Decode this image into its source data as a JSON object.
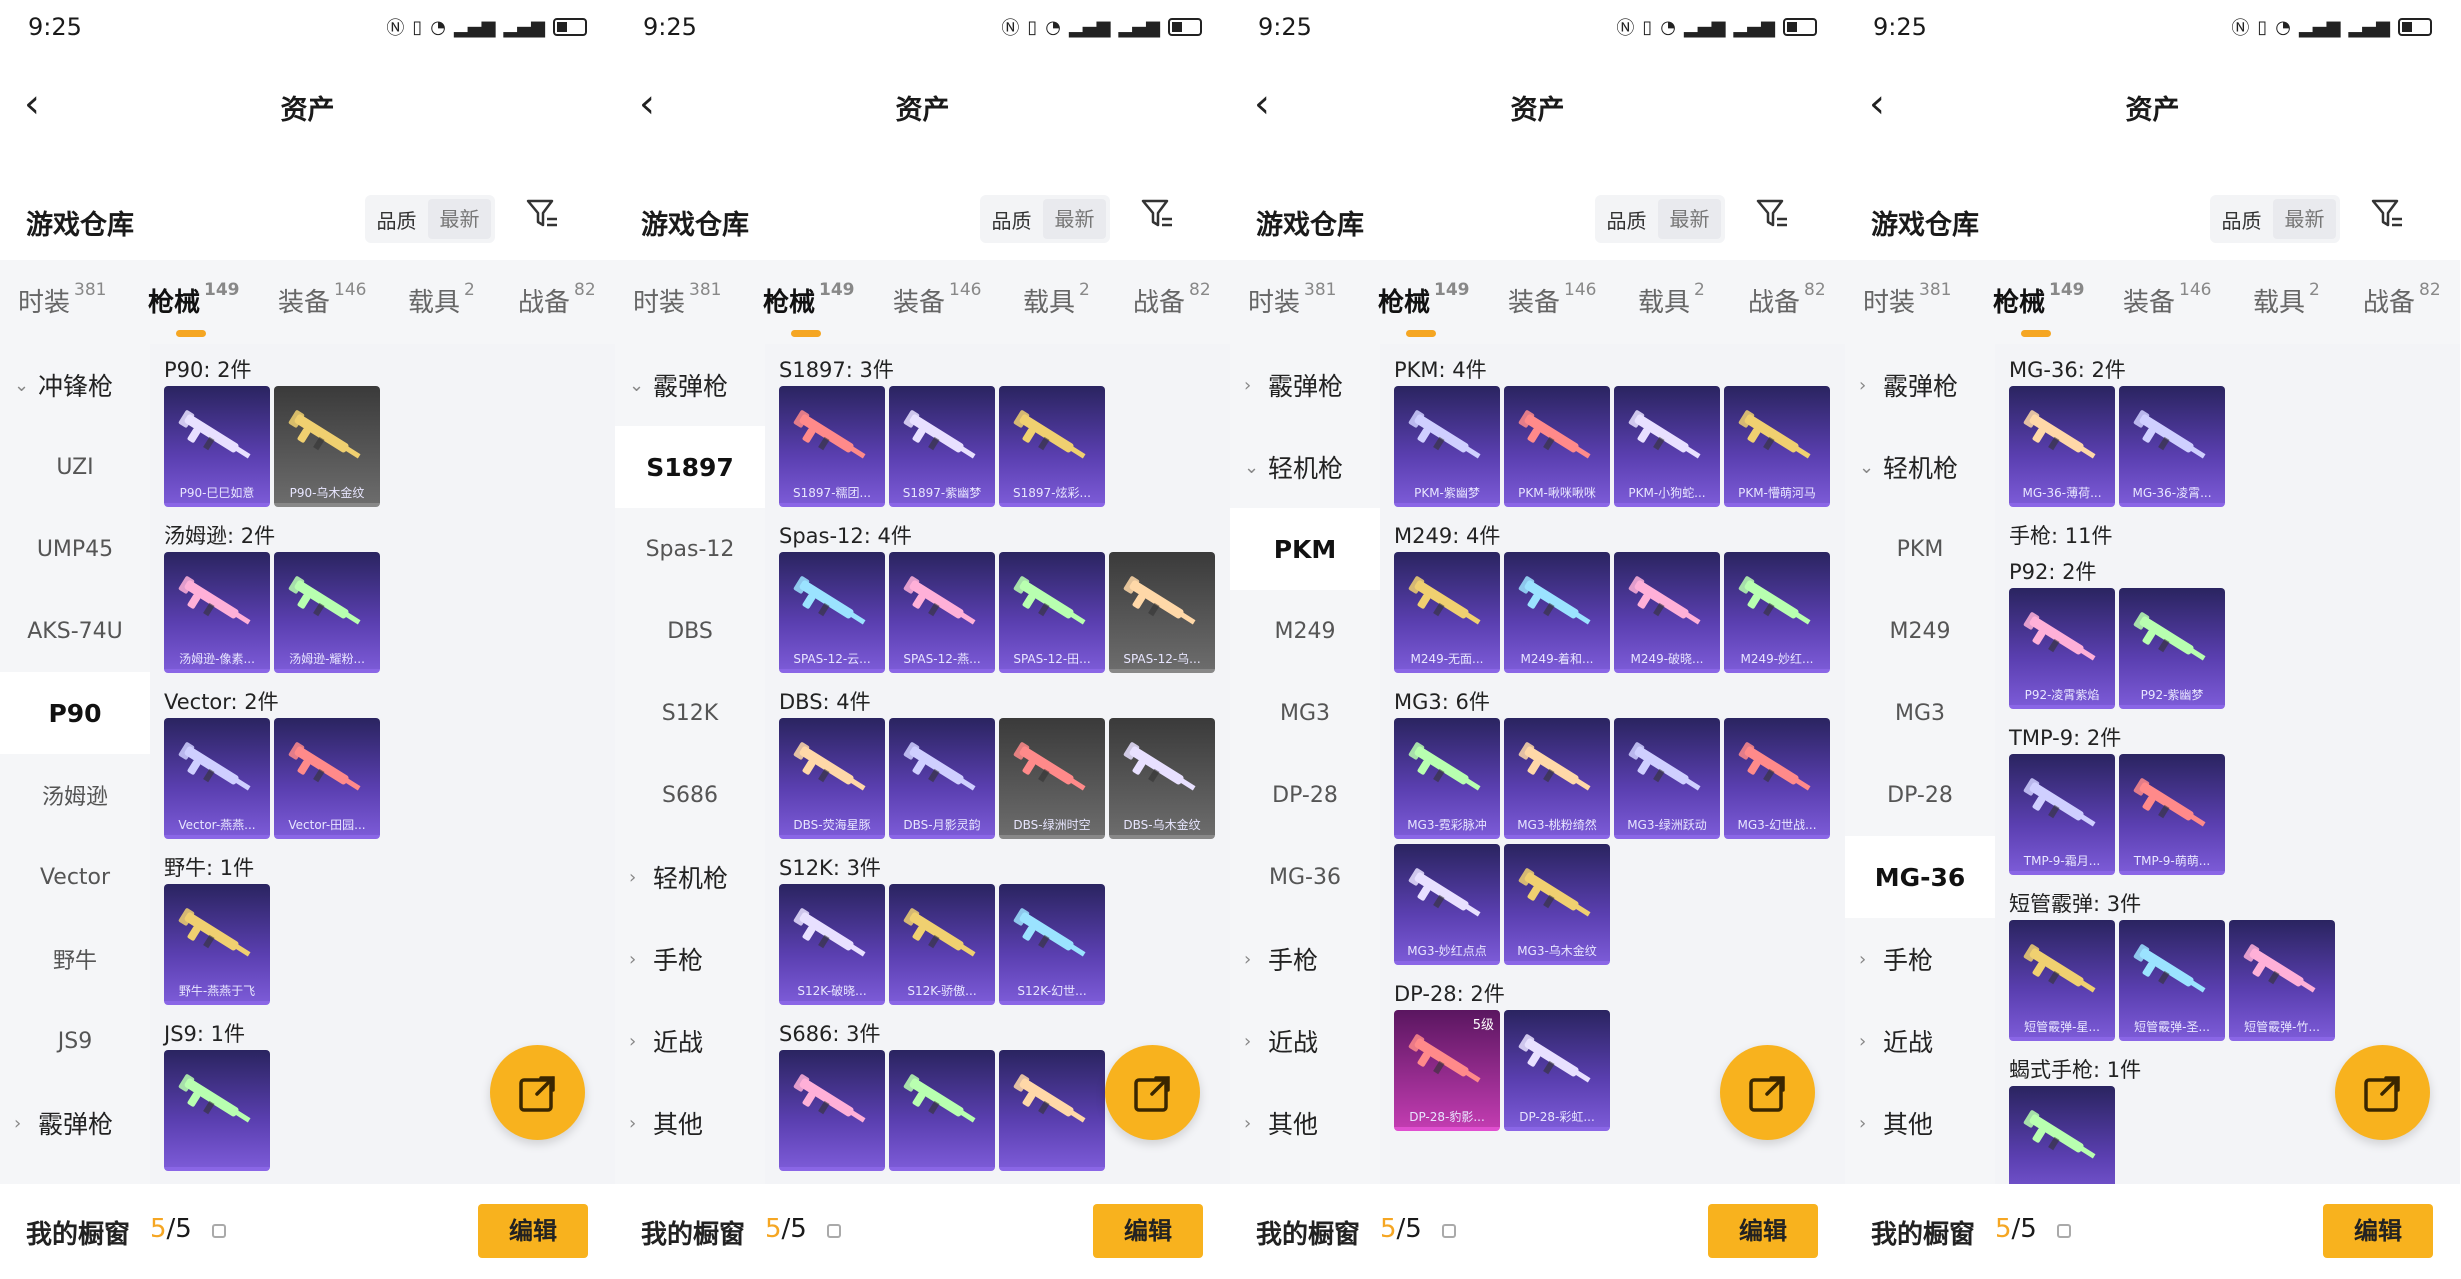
{
  "status": {
    "time": "9:25",
    "icons": [
      "nfc-icon",
      "vibrate-icon",
      "wifi-icon",
      "signal-icon",
      "signal-icon",
      "battery-icon"
    ]
  },
  "common": {
    "title": "资产",
    "warehouse": "游戏仓库",
    "sort_quality": "品质",
    "sort_latest": "最新",
    "tabs": [
      {
        "label": "时装",
        "count": "381"
      },
      {
        "label": "枪械",
        "count": "149"
      },
      {
        "label": "装备",
        "count": "146"
      },
      {
        "label": "载具",
        "count": "2"
      },
      {
        "label": "战备",
        "count": "82"
      }
    ],
    "bottom_title": "我的橱窗",
    "bottom_count_a": "5",
    "bottom_count_b": "/5",
    "edit": "编辑"
  },
  "phones": [
    {
      "sidebar": [
        {
          "label": "冲锋枪",
          "type": "cat",
          "chev": "⌄"
        },
        {
          "label": "UZI",
          "type": "sub"
        },
        {
          "label": "UMP45",
          "type": "sub"
        },
        {
          "label": "AKS-74U",
          "type": "sub"
        },
        {
          "label": "P90",
          "type": "sel"
        },
        {
          "label": "汤姆逊",
          "type": "sub"
        },
        {
          "label": "Vector",
          "type": "sub"
        },
        {
          "label": "野牛",
          "type": "sub"
        },
        {
          "label": "JS9",
          "type": "sub"
        },
        {
          "label": "霰弹枪",
          "type": "cat",
          "chev": "›"
        }
      ],
      "groups": [
        {
          "title": "P90: 2件",
          "items": [
            {
              "label": "P90-巳巳如意",
              "tone": "purple"
            },
            {
              "label": "P90-乌木金纹",
              "tone": "gray"
            }
          ]
        },
        {
          "title": "汤姆逊: 2件",
          "items": [
            {
              "label": "汤姆逊-像素...",
              "tone": "purple"
            },
            {
              "label": "汤姆逊-耀粉...",
              "tone": "purple"
            }
          ]
        },
        {
          "title": "Vector: 2件",
          "items": [
            {
              "label": "Vector-燕燕...",
              "tone": "purple"
            },
            {
              "label": "Vector-田园...",
              "tone": "purple"
            }
          ]
        },
        {
          "title": "野牛: 1件",
          "items": [
            {
              "label": "野牛-燕燕于飞",
              "tone": "purple"
            }
          ]
        },
        {
          "title": "JS9: 1件",
          "items": [
            {
              "label": "",
              "tone": "purple"
            }
          ]
        }
      ]
    },
    {
      "sidebar": [
        {
          "label": "霰弹枪",
          "type": "cat",
          "chev": "⌄"
        },
        {
          "label": "S1897",
          "type": "sel"
        },
        {
          "label": "Spas-12",
          "type": "sub"
        },
        {
          "label": "DBS",
          "type": "sub"
        },
        {
          "label": "S12K",
          "type": "sub"
        },
        {
          "label": "S686",
          "type": "sub"
        },
        {
          "label": "轻机枪",
          "type": "cat",
          "chev": "›"
        },
        {
          "label": "手枪",
          "type": "cat",
          "chev": "›"
        },
        {
          "label": "近战",
          "type": "cat",
          "chev": "›"
        },
        {
          "label": "其他",
          "type": "cat",
          "chev": "›"
        }
      ],
      "groups": [
        {
          "title": "S1897: 3件",
          "items": [
            {
              "label": "S1897-糯团...",
              "tone": "purple"
            },
            {
              "label": "S1897-紫幽梦",
              "tone": "purple"
            },
            {
              "label": "S1897-炫彩...",
              "tone": "purple"
            }
          ]
        },
        {
          "title": "Spas-12: 4件",
          "items": [
            {
              "label": "SPAS-12-云...",
              "tone": "purple"
            },
            {
              "label": "SPAS-12-燕...",
              "tone": "purple"
            },
            {
              "label": "SPAS-12-田...",
              "tone": "purple"
            },
            {
              "label": "SPAS-12-乌...",
              "tone": "gray"
            }
          ]
        },
        {
          "title": "DBS: 4件",
          "items": [
            {
              "label": "DBS-荧海星豚",
              "tone": "purple"
            },
            {
              "label": "DBS-月影灵韵",
              "tone": "purple"
            },
            {
              "label": "DBS-绿洲时空",
              "tone": "gray"
            },
            {
              "label": "DBS-乌木金纹",
              "tone": "gray"
            }
          ]
        },
        {
          "title": "S12K: 3件",
          "items": [
            {
              "label": "S12K-破晓...",
              "tone": "purple"
            },
            {
              "label": "S12K-骄傲...",
              "tone": "purple"
            },
            {
              "label": "S12K-幻世...",
              "tone": "purple"
            }
          ]
        },
        {
          "title": "S686: 3件",
          "items": [
            {
              "label": "",
              "tone": "purple"
            },
            {
              "label": "",
              "tone": "purple"
            },
            {
              "label": "",
              "tone": "purple"
            }
          ]
        }
      ]
    },
    {
      "sidebar": [
        {
          "label": "霰弹枪",
          "type": "cat",
          "chev": "›"
        },
        {
          "label": "轻机枪",
          "type": "cat",
          "chev": "⌄"
        },
        {
          "label": "PKM",
          "type": "sel"
        },
        {
          "label": "M249",
          "type": "sub"
        },
        {
          "label": "MG3",
          "type": "sub"
        },
        {
          "label": "DP-28",
          "type": "sub"
        },
        {
          "label": "MG-36",
          "type": "sub"
        },
        {
          "label": "手枪",
          "type": "cat",
          "chev": "›"
        },
        {
          "label": "近战",
          "type": "cat",
          "chev": "›"
        },
        {
          "label": "其他",
          "type": "cat",
          "chev": "›"
        }
      ],
      "groups": [
        {
          "title": "PKM: 4件",
          "items": [
            {
              "label": "PKM-紫幽梦",
              "tone": "purple"
            },
            {
              "label": "PKM-啾咪啾咪",
              "tone": "purple"
            },
            {
              "label": "PKM-小狗蛇...",
              "tone": "purple"
            },
            {
              "label": "PKM-懵萌河马",
              "tone": "purple"
            }
          ]
        },
        {
          "title": "M249: 4件",
          "items": [
            {
              "label": "M249-无面...",
              "tone": "purple"
            },
            {
              "label": "M249-着和...",
              "tone": "purple"
            },
            {
              "label": "M249-破晓...",
              "tone": "purple"
            },
            {
              "label": "M249-妙红...",
              "tone": "purple"
            }
          ]
        },
        {
          "title": "MG3: 6件",
          "items": [
            {
              "label": "MG3-霓彩脉冲",
              "tone": "purple"
            },
            {
              "label": "MG3-桃粉绮然",
              "tone": "purple"
            },
            {
              "label": "MG3-绿洲跃动",
              "tone": "purple"
            },
            {
              "label": "MG3-幻世战...",
              "tone": "purple"
            },
            {
              "label": "MG3-妙红点点",
              "tone": "purple"
            },
            {
              "label": "MG3-乌木金纹",
              "tone": "purple"
            }
          ]
        },
        {
          "title": "DP-28: 2件",
          "items": [
            {
              "label": "DP-28-豹影...",
              "tone": "pink",
              "level": "5级"
            },
            {
              "label": "DP-28-彩虹...",
              "tone": "purple"
            }
          ]
        }
      ]
    },
    {
      "sidebar": [
        {
          "label": "霰弹枪",
          "type": "cat",
          "chev": "›"
        },
        {
          "label": "轻机枪",
          "type": "cat",
          "chev": "⌄"
        },
        {
          "label": "PKM",
          "type": "sub"
        },
        {
          "label": "M249",
          "type": "sub"
        },
        {
          "label": "MG3",
          "type": "sub"
        },
        {
          "label": "DP-28",
          "type": "sub"
        },
        {
          "label": "MG-36",
          "type": "sel"
        },
        {
          "label": "手枪",
          "type": "cat",
          "chev": "›"
        },
        {
          "label": "近战",
          "type": "cat",
          "chev": "›"
        },
        {
          "label": "其他",
          "type": "cat",
          "chev": "›"
        }
      ],
      "groups": [
        {
          "title": "MG-36: 2件",
          "items": [
            {
              "label": "MG-36-薄荷...",
              "tone": "purple"
            },
            {
              "label": "MG-36-凌霄...",
              "tone": "purple"
            }
          ]
        },
        {
          "title": "手枪: 11件",
          "items": []
        },
        {
          "title": "P92: 2件",
          "items": [
            {
              "label": "P92-凌霄紫焰",
              "tone": "purple"
            },
            {
              "label": "P92-紫幽梦",
              "tone": "purple"
            }
          ]
        },
        {
          "title": "TMP-9: 2件",
          "items": [
            {
              "label": "TMP-9-霜月...",
              "tone": "purple"
            },
            {
              "label": "TMP-9-萌萌...",
              "tone": "purple"
            }
          ]
        },
        {
          "title": "短管霰弹: 3件",
          "items": [
            {
              "label": "短管霰弹-星...",
              "tone": "purple"
            },
            {
              "label": "短管霰弹-圣...",
              "tone": "purple"
            },
            {
              "label": "短管霰弹-竹...",
              "tone": "purple"
            }
          ]
        },
        {
          "title": "蝎式手枪: 1件",
          "items": [
            {
              "label": "",
              "tone": "purple"
            }
          ]
        }
      ]
    }
  ],
  "colors": {
    "accent": "#f8b21e",
    "card_purple": "#5a3fb0",
    "card_gray": "#6c6c6c"
  }
}
